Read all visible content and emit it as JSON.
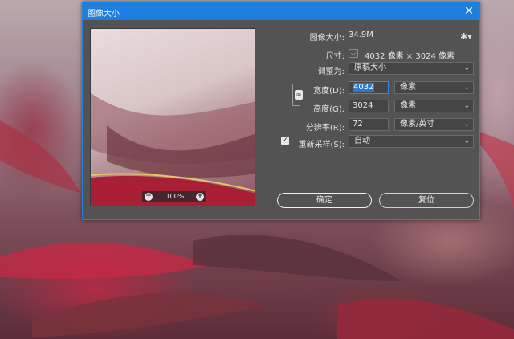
{
  "dialog": {
    "title": "图像大小",
    "close_icon": "close-icon"
  },
  "preview": {
    "zoom_value": "100%",
    "zoom_out_symbol": "−",
    "zoom_in_symbol": "+"
  },
  "info": {
    "image_size_label": "图像大小:",
    "image_size_value": "34.9M",
    "dimensions_label": "尺寸:",
    "dimensions_value": "4032 像素 × 3024 像素",
    "fit_to_label": "调整为:",
    "fit_to_value": "原稿大小"
  },
  "fields": {
    "width_label": "宽度(D):",
    "width_value": "4032",
    "width_unit": "像素",
    "height_label": "高度(G):",
    "height_value": "3024",
    "height_unit": "像素",
    "resolution_label": "分辨率(R):",
    "resolution_value": "72",
    "resolution_unit": "像素/英寸",
    "resample_label": "重新采样(S):",
    "resample_value": "自动",
    "resample_checked": true
  },
  "buttons": {
    "ok_label": "确定",
    "reset_label": "复位"
  },
  "colors": {
    "titlebar": "#1e7ee0",
    "dialog_bg": "#535353",
    "focus": "#2e8be8"
  }
}
